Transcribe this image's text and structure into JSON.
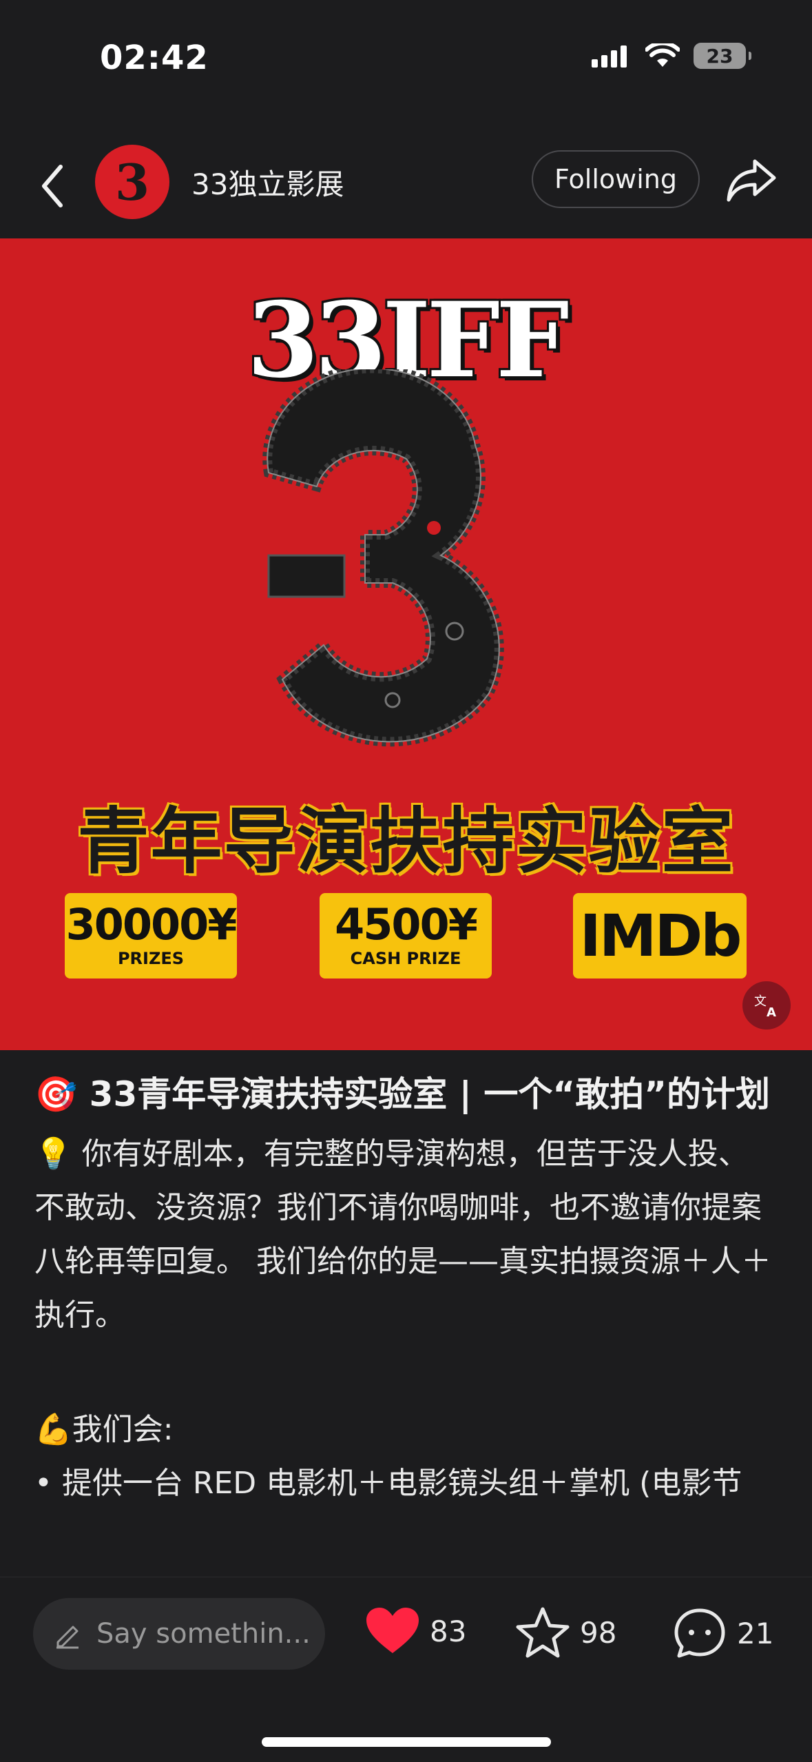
{
  "status": {
    "time": "02:42",
    "battery": "23"
  },
  "header": {
    "account_name": "33独立影展",
    "follow_label": "Following",
    "avatar_glyph": "3"
  },
  "poster": {
    "title": "33IFF",
    "subtitle": "青年导演扶持实验室",
    "badges": [
      {
        "big": "30000¥",
        "small": "PRIZES"
      },
      {
        "big": "4500¥",
        "small": "CASH PRIZE"
      },
      {
        "big": "IMDb",
        "small": ""
      }
    ]
  },
  "post": {
    "title": "🎯 33青年导演扶持实验室 | 一个“敢拍”的计划",
    "para1": "💡 你有好剧本，有完整的导演构想，但苦于没人投、不敢动、没资源？我们不请你喝咖啡，也不邀请你提案八轮再等回复。 我们给你的是——真实拍摄资源＋人＋执行。",
    "para2": "💪我们会:",
    "para3": "• 提供一台 RED 电影机＋电影镜头组＋掌机 (电影节"
  },
  "bottom": {
    "input_placeholder": "Say somethin...",
    "likes": "83",
    "stars": "98",
    "comments": "21"
  },
  "colors": {
    "poster_red": "#cf1d22",
    "badge_yellow": "#f7c20d",
    "like_red": "#ff2442"
  },
  "icons": [
    "back-icon",
    "share-icon",
    "translate-icon",
    "pencil-icon",
    "heart-icon",
    "star-icon",
    "comment-icon",
    "signal-icon",
    "wifi-icon",
    "battery-icon"
  ]
}
